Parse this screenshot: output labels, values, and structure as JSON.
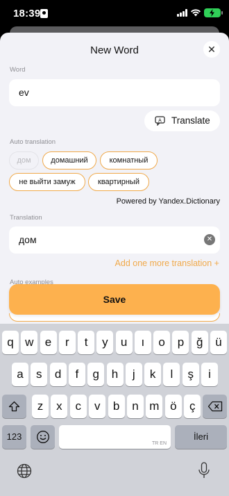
{
  "status_bar": {
    "time": "18:39"
  },
  "sheet": {
    "title": "New Word",
    "close_icon": "close-icon"
  },
  "word": {
    "label": "Word",
    "value": "ev"
  },
  "translate_button": {
    "label": "Translate",
    "icon": "translate-icon"
  },
  "auto_translation": {
    "label": "Auto translation",
    "chips": [
      "дом",
      "домашний",
      "комнатный",
      "не выйти замуж",
      "квартирный"
    ],
    "powered_by": "Powered by Yandex.Dictionary"
  },
  "translation": {
    "label": "Translation",
    "value": "дом",
    "add_more": "Add one more translation +"
  },
  "auto_examples": {
    "label": "Auto examples"
  },
  "save_button": {
    "label": "Save"
  },
  "keyboard": {
    "row1": [
      "q",
      "w",
      "e",
      "r",
      "t",
      "y",
      "u",
      "ı",
      "o",
      "p",
      "ğ",
      "ü"
    ],
    "row2": [
      "a",
      "s",
      "d",
      "f",
      "g",
      "h",
      "j",
      "k",
      "l",
      "ş",
      "i"
    ],
    "row3": [
      "z",
      "x",
      "c",
      "v",
      "b",
      "n",
      "m",
      "ö",
      "ç"
    ],
    "numbers_key": "123",
    "space_hint": "TR EN",
    "return_key": "İleri"
  },
  "colors": {
    "accent": "#f0a94a",
    "save_button": "#fdb14e",
    "battery": "#30d158"
  }
}
